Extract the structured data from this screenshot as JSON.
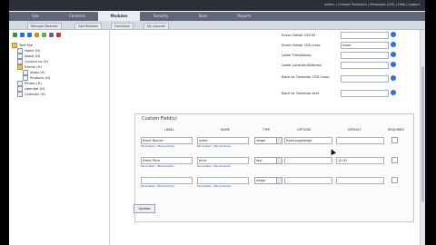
{
  "header": {
    "top_links": "admin | Change Password | Messages (0/0) | Help | Logout",
    "tabs": [
      {
        "label": "Site"
      },
      {
        "label": "Contents"
      },
      {
        "label": "Modules"
      },
      {
        "label": "Security"
      },
      {
        "label": "Tools"
      },
      {
        "label": "Reports"
      }
    ],
    "subtabs": [
      {
        "label": "Manage Modules"
      },
      {
        "label": "Get Modules"
      },
      {
        "label": "Functions"
      },
      {
        "label": "My Layouts"
      }
    ]
  },
  "sidebar": {
    "tree": [
      {
        "label": "Test Site",
        "icon": "folder-icon"
      },
      {
        "label": "Home (H)",
        "icon": "page-icon"
      },
      {
        "label": "About (H)",
        "icon": "page-icon"
      },
      {
        "label": "Contact us (H)",
        "icon": "page-icon"
      },
      {
        "label": "Events (H)",
        "icon": "folder-icon"
      },
      {
        "label": "Video (H)",
        "icon": "page-icon"
      },
      {
        "label": "Products (H)",
        "icon": "page-icon"
      },
      {
        "label": "Photos (H)",
        "icon": "page-icon"
      },
      {
        "label": "calendar (H)",
        "icon": "page-icon"
      },
      {
        "label": "Calendar (H)",
        "icon": "page-icon"
      }
    ]
  },
  "settings": [
    {
      "label": "Event Detail CSS ID",
      "value": ""
    },
    {
      "label": "Event Detail CSS class",
      "value": "event"
    },
    {
      "label": "Label Timestamp",
      "value": ""
    },
    {
      "label": "Label Location/Address",
      "value": ""
    },
    {
      "label": "Back to Calendar CSS Class",
      "value": ""
    },
    {
      "label": "Back to Calendar text",
      "value": ""
    }
  ],
  "custom_fields": {
    "title": "Custom Field(s)",
    "columns": [
      "LABEL",
      "NAME",
      "TYPE",
      "OPTIONS",
      "DEFAULT",
      "REQUIRED"
    ],
    "rows": [
      {
        "label": "Event Banner",
        "name": "event",
        "type": "image",
        "options": "EventLogoImage",
        "default": "",
        "param": "Parameter: (Placeholder)"
      },
      {
        "label": "Event Price",
        "name": "price",
        "type": "text",
        "options": "",
        "default": "12.00",
        "param": "Parameter: (Placeholder)"
      },
      {
        "label": "",
        "name": "",
        "type": "image",
        "options": "",
        "default": "",
        "param": "Parameter: (Placeholder)"
      }
    ]
  },
  "update_label": "Update",
  "colors": {
    "accent": "#2f6fd6",
    "header_bg": "#2b2f3a",
    "tab_bg": "#5f6778"
  }
}
